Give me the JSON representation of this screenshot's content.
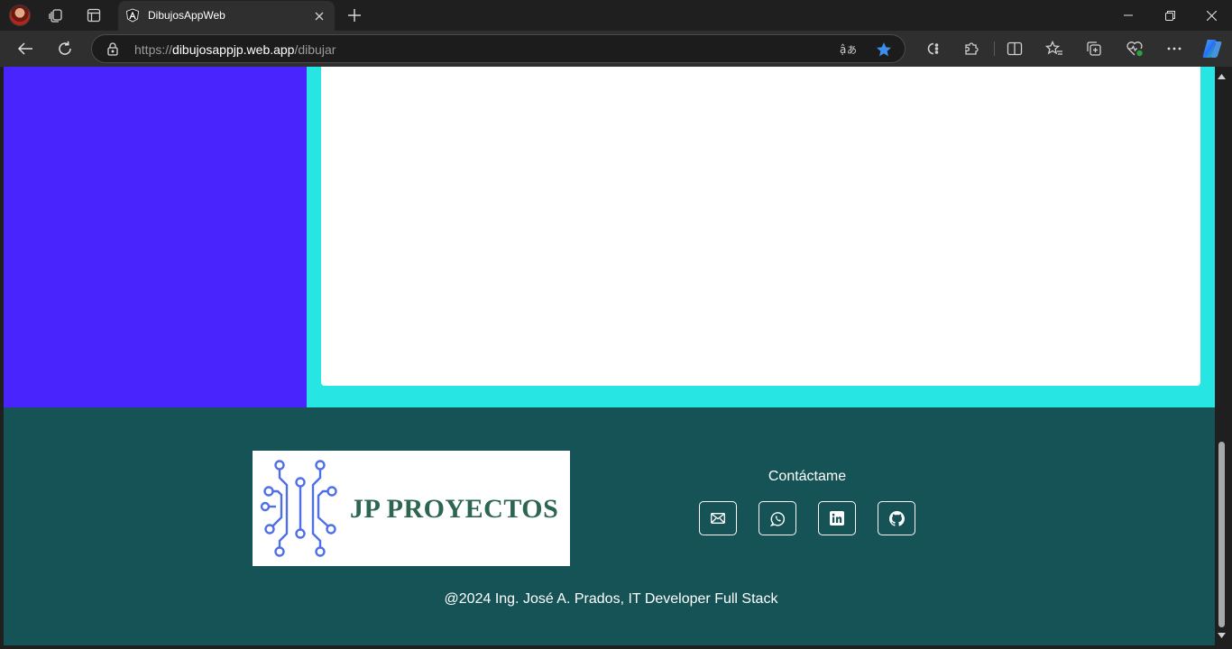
{
  "browser": {
    "tab": {
      "title": "DibujosAppWeb",
      "favicon": "angular-icon"
    },
    "url": {
      "scheme": "https://",
      "host": "dibujosappjp.web.app",
      "path": "/dibujar"
    },
    "icons": {
      "back": "back-arrow-icon",
      "reload": "reload-icon",
      "lock": "lock-icon",
      "read_aloud": "read-aloud-icon",
      "favorite": "star-icon",
      "copilot": "copilot-icon"
    },
    "accent": "#3b8eea"
  },
  "page": {
    "colors": {
      "sidebar": "#4a24fd",
      "canvas_frame": "#26e5e2",
      "canvas": "#ffffff",
      "footer": "#155356"
    },
    "logo": {
      "text": "JP PROYECTOS",
      "color": "#2c6650",
      "circuit_color": "#4f6fe6"
    },
    "contact": {
      "title": "Contáctame",
      "links": [
        {
          "name": "email-icon"
        },
        {
          "name": "whatsapp-icon"
        },
        {
          "name": "linkedin-icon"
        },
        {
          "name": "github-icon"
        }
      ]
    },
    "copyright": "@2024 Ing. José A. Prados, IT Developer Full Stack"
  }
}
